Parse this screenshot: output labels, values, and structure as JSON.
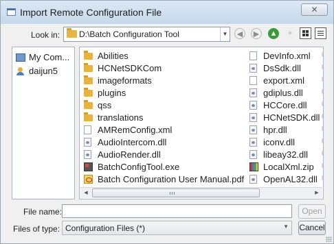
{
  "window": {
    "title": "Import Remote Configuration File",
    "close_glyph": "✕"
  },
  "toolbar": {
    "look_in_label": "Look in:",
    "look_in_value": "D:\\Batch Configuration Tool",
    "back_glyph": "◀",
    "forward_glyph": "▶",
    "up_glyph": "▲",
    "new_folder_glyph": "✦",
    "combo_arrow_glyph": "▼"
  },
  "sidebar": {
    "items": [
      {
        "label": "My Com...",
        "icon": "computer-icon"
      },
      {
        "label": "daijun5",
        "icon": "user-folder-icon"
      }
    ]
  },
  "files": {
    "column1": [
      {
        "name": "Abilities",
        "type": "folder"
      },
      {
        "name": "HCNetSDKCom",
        "type": "folder"
      },
      {
        "name": "imageformats",
        "type": "folder"
      },
      {
        "name": "plugins",
        "type": "folder"
      },
      {
        "name": "qss",
        "type": "folder"
      },
      {
        "name": "translations",
        "type": "folder"
      },
      {
        "name": "AMRemConfig.xml",
        "type": "file"
      },
      {
        "name": "AudioIntercom.dll",
        "type": "dll"
      },
      {
        "name": "AudioRender.dll",
        "type": "dll"
      },
      {
        "name": "BatchConfigTool.exe",
        "type": "exe"
      },
      {
        "name": "Batch Configuration User Manual.pdf",
        "type": "pdf"
      }
    ],
    "column2": [
      {
        "name": "DevInfo.xml",
        "type": "file"
      },
      {
        "name": "DsSdk.dll",
        "type": "dll"
      },
      {
        "name": "export.xml",
        "type": "file"
      },
      {
        "name": "gdiplus.dll",
        "type": "dll"
      },
      {
        "name": "HCCore.dll",
        "type": "dll"
      },
      {
        "name": "HCNetSDK.dll",
        "type": "dll"
      },
      {
        "name": "hpr.dll",
        "type": "dll"
      },
      {
        "name": "iconv.dll",
        "type": "dll"
      },
      {
        "name": "libeay32.dll",
        "type": "dll"
      },
      {
        "name": "LocalXml.zip",
        "type": "zip"
      },
      {
        "name": "OpenAL32.dll",
        "type": "dll"
      }
    ]
  },
  "scrollbar": {
    "left_glyph": "◀",
    "right_glyph": "▶"
  },
  "footer": {
    "file_name_label": "File name:",
    "file_name_value": "",
    "open_label": "Open",
    "files_of_type_label": "Files of type:",
    "files_of_type_value": "Configuration Files (*)",
    "type_arrow_glyph": "▼",
    "cancel_label": "Cancel"
  }
}
